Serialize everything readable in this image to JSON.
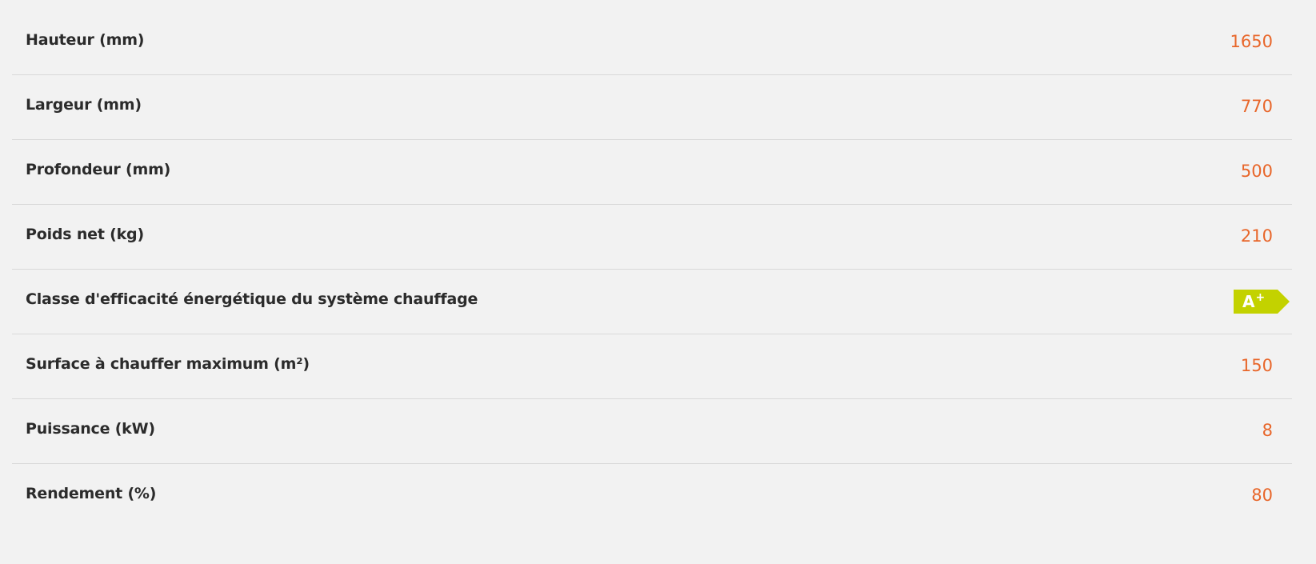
{
  "specs": [
    {
      "label": "Hauteur (mm)",
      "value": "1650"
    },
    {
      "label": "Largeur (mm)",
      "value": "770"
    },
    {
      "label": "Profondeur (mm)",
      "value": "500"
    },
    {
      "label": "Poids net (kg)",
      "value": "210"
    },
    {
      "label": "Classe d'efficacité énergétique du système chauffage",
      "badge": {
        "letter": "A",
        "modifier": "+",
        "color": "#c3d200"
      }
    },
    {
      "label": "Surface à chauffer maximum (m²)",
      "value": "150"
    },
    {
      "label": "Puissance (kW)",
      "value": "8"
    },
    {
      "label": "Rendement (%)",
      "value": "80"
    }
  ],
  "colors": {
    "background": "#f2f2f2",
    "label": "#2b2b2b",
    "value": "#e8662a",
    "divider": "#d9d9d9",
    "energy_badge": "#c3d200"
  }
}
